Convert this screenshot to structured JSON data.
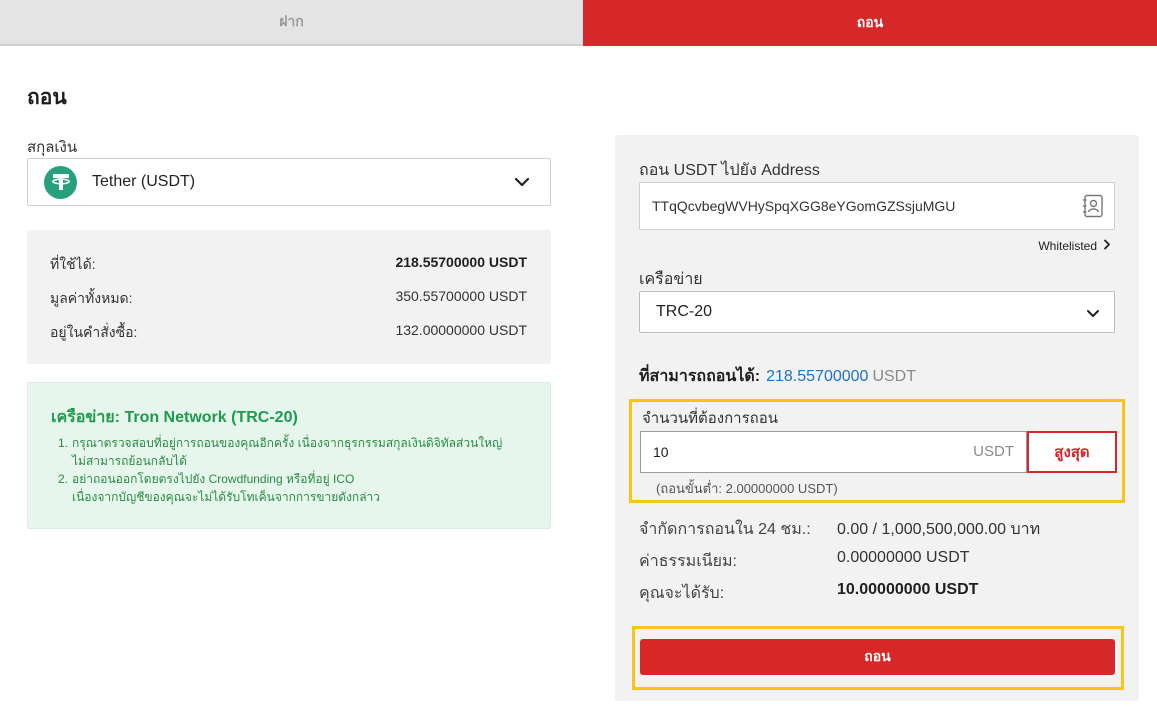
{
  "tabs": {
    "deposit": "ฝาก",
    "withdraw": "ถอน"
  },
  "page_title": "ถอน",
  "currency": {
    "label": "สกุลเงิน",
    "selected": "Tether (USDT)",
    "icon": "tether-icon"
  },
  "balances": [
    {
      "label": "ที่ใช้ได้:",
      "value": "218.55700000 USDT"
    },
    {
      "label": "มูลค่าทั้งหมด:",
      "value": "350.55700000 USDT"
    },
    {
      "label": "อยู่ในคำสั่งซื้อ:",
      "value": "132.00000000 USDT"
    }
  ],
  "network_notice": {
    "title": "เครือข่าย: Tron Network (TRC-20)",
    "items": [
      {
        "num": "1.",
        "line1": "กรุณาตรวจสอบที่อยู่การถอนของคุณอีกครั้ง เนื่องจากธุรกรรมสกุลเงินดิจิทัลส่วนใหญ่",
        "line2": "ไม่สามารถย้อนกลับได้"
      },
      {
        "num": "2.",
        "line1": "อย่าถอนออกโดยตรงไปยัง Crowdfunding หรือที่อยู่ ICO",
        "line2": "เนื่องจากบัญชีของคุณจะไม่ได้รับโทเค็นจากการขายดังกล่าว"
      }
    ]
  },
  "withdraw_form": {
    "address_label": "ถอน USDT ไปยัง Address",
    "address_value": "TTqQcvbegWVHySpqXGG8eYGomGZSsjuMGU",
    "whitelisted": "Whitelisted",
    "network_label": "เครือข่าย",
    "network_value": "TRC-20",
    "available_label": "ที่สามารถถอนได้:",
    "available_value": "218.55700000",
    "available_unit": "USDT",
    "amount_label": "จำนวนที่ต้องการถอน",
    "amount_value": "10",
    "amount_unit": "USDT",
    "max_label": "สูงสุด",
    "min_note": "(ถอนขั้นต่ำ: 2.00000000 USDT)",
    "limit_label": "จำกัดการถอนใน 24 ชม.:",
    "limit_value": "0.00 / 1,000,500,000.00 บาท",
    "fee_label": "ค่าธรรมเนียม:",
    "fee_value": "0.00000000 USDT",
    "receive_label": "คุณจะได้รับ:",
    "receive_value": "10.00000000 USDT",
    "submit_label": "ถอน"
  },
  "colors": {
    "brand_red": "#d62828",
    "highlight_yellow": "#f5c518",
    "link_blue": "#1a73c9",
    "notice_green": "#1f9a4e",
    "tether_green": "#26a17b"
  }
}
